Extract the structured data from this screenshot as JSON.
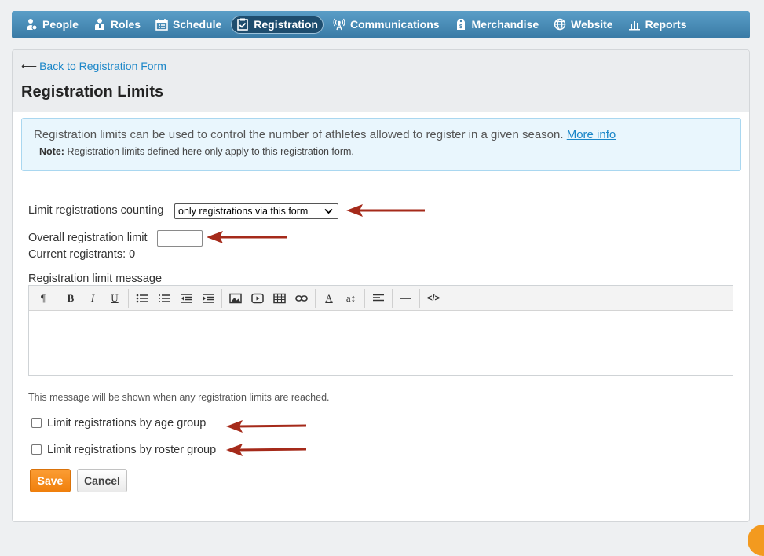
{
  "nav": {
    "items": [
      {
        "label": "People",
        "icon": "people-icon"
      },
      {
        "label": "Roles",
        "icon": "roles-icon"
      },
      {
        "label": "Schedule",
        "icon": "calendar-icon"
      },
      {
        "label": "Registration",
        "icon": "clipboard-check-icon",
        "active": true
      },
      {
        "label": "Communications",
        "icon": "antenna-icon"
      },
      {
        "label": "Merchandise",
        "icon": "price-tag-icon"
      },
      {
        "label": "Website",
        "icon": "globe-icon"
      },
      {
        "label": "Reports",
        "icon": "bar-chart-icon"
      }
    ]
  },
  "page": {
    "back_arrow": "⟵",
    "back_link": "Back to Registration Form",
    "title": "Registration Limits"
  },
  "info": {
    "text": "Registration limits can be used to control the number of athletes allowed to register in a given season.",
    "link": "More info",
    "note_label": "Note:",
    "note_text": "Registration limits defined here only apply to this registration form."
  },
  "form": {
    "counting_label": "Limit registrations counting",
    "counting_selected": "only registrations via this form",
    "overall_label": "Overall registration limit",
    "overall_value": "",
    "current_label": "Current registrants: 0",
    "message_label": "Registration limit message",
    "message_value": "",
    "hint": "This message will be shown when any registration limits are reached.",
    "age_group_label": "Limit registrations by age group",
    "age_group_checked": false,
    "roster_group_label": "Limit registrations by roster group",
    "roster_group_checked": false
  },
  "buttons": {
    "save": "Save",
    "cancel": "Cancel"
  },
  "toolbar": {
    "paragraph": "¶",
    "bold": "B",
    "italic": "I",
    "underline": "U",
    "font_color": "A",
    "font_size": "a↕",
    "source": "</>"
  },
  "colors": {
    "nav_bg": "#4a8cb7",
    "link": "#1a86c8",
    "save": "#f58a14",
    "info_bg": "#e9f6fd",
    "annotation_arrow": "#a52a1a"
  }
}
